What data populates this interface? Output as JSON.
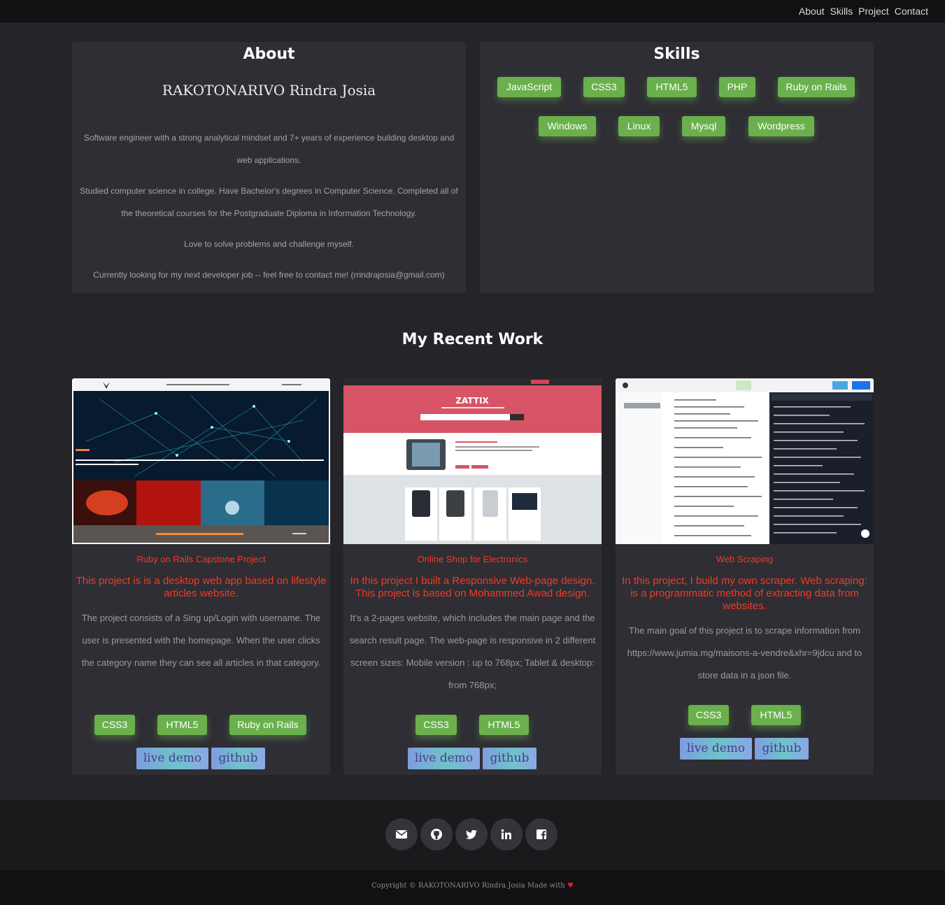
{
  "nav": {
    "items": [
      "About",
      "Skills",
      "Project",
      "Contact"
    ]
  },
  "about": {
    "title": "About",
    "name": "RAKOTONARIVO Rindra Josia",
    "paragraphs": [
      "Software engineer with a strong analytical mindset and 7+ years of experience building desktop and web applications.",
      "Studied computer science in college. Have Bachelor's degrees in Computer Science. Completed all of the theoretical courses for the Postgraduate Diploma in Information Technology.",
      "Love to solve problems and challenge myself.",
      "Currently looking for my next developer job -- feel free to contact me! (rrindrajosia@gmail.com)"
    ]
  },
  "skills": {
    "title": "Skills",
    "items": [
      "JavaScript",
      "CSS3",
      "HTML5",
      "PHP",
      "Ruby on Rails",
      "Windows",
      "Linux",
      "Mysql",
      "Wordpress"
    ]
  },
  "work": {
    "title": "My Recent Work",
    "projects": [
      {
        "name": "Ruby on Rails Capstone Project",
        "lead": "This project is is a desktop web app based on lifestyle articles website.",
        "description": "The project consists of a Sing up/Login with username. The user is presented with the homepage. When the user clicks the category name they can see all articles in that category.",
        "tags": [
          "CSS3",
          "HTML5",
          "Ruby on Rails"
        ],
        "live_label": "live demo",
        "github_label": "github"
      },
      {
        "name": "Online Shop for Electronics",
        "lead": "In this project I built a Responsive Web-page design. This project is based on Mohammed Awad design.",
        "description": "It's a 2-pages website, which includes the main page and the search result page. The web-page is responsive in 2 different screen sizes: Mobile version : up to 768px; Tablet & desktop: from 768px;",
        "tags": [
          "CSS3",
          "HTML5"
        ],
        "live_label": "live demo",
        "github_label": "github",
        "shot_brand": "ZATTIX"
      },
      {
        "name": "Web Scraping",
        "lead": "In this project, I build my own scraper. Web scraping: is a programmatic method of extracting data from websites.",
        "description": "The main goal of this project is to scrape information from https://www.jumia.mg/maisons-a-vendre&xhr=9jdcu and to store data in a json file.",
        "tags": [
          "CSS3",
          "HTML5"
        ],
        "live_label": "live demo",
        "github_label": "github"
      }
    ]
  },
  "footer": {
    "social": [
      "envelope-icon",
      "github-icon",
      "twitter-icon",
      "linkedin-icon",
      "facebook-icon"
    ],
    "copyright": "Copyright © RAKOTONARIVO Rindra Josia Made with",
    "heart": "♥"
  },
  "colors": {
    "background": "#242429",
    "panel": "#2e2e34",
    "accent_red": "#f03b26",
    "chip_green": "#6ab04c",
    "nav": "#111113"
  }
}
